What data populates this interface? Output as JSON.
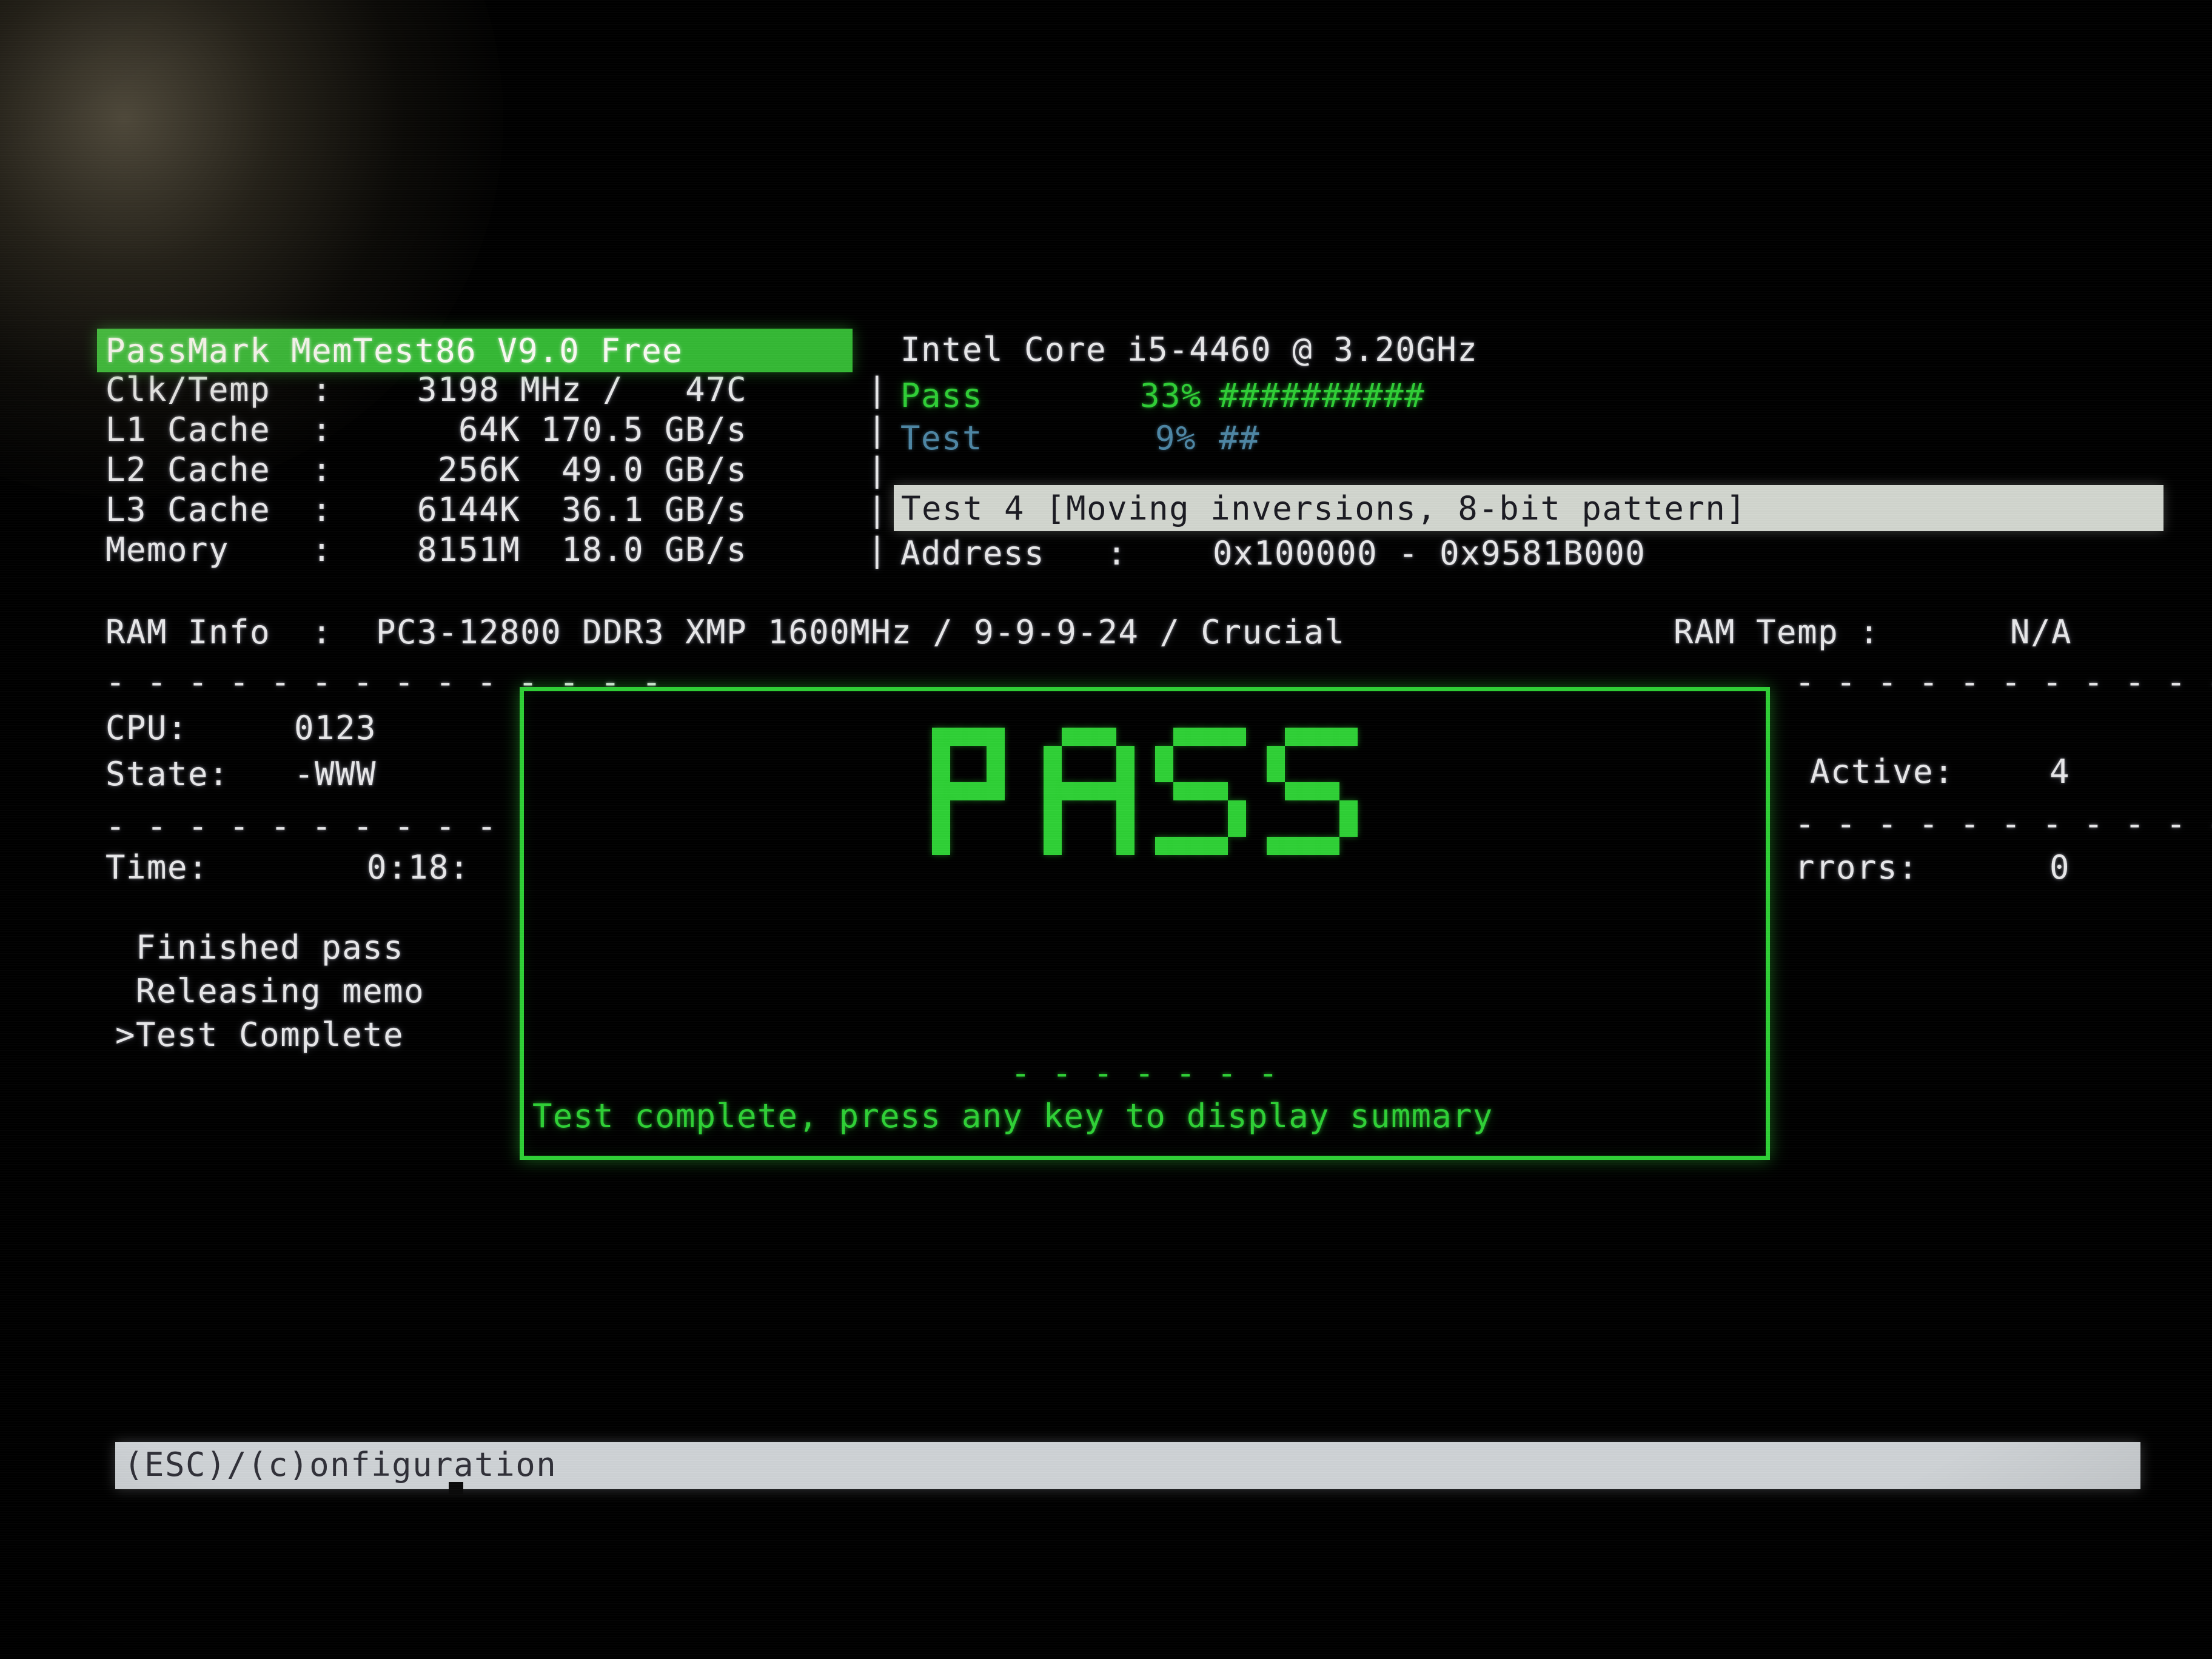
{
  "app": {
    "title": "PassMark MemTest86 V9.0 Free",
    "cpu_model": "Intel Core i5-4460 @ 3.20GHz"
  },
  "system_info": {
    "rows": [
      {
        "label": "Clk/Temp  :",
        "value": "  3198 MHz /   47C"
      },
      {
        "label": "L1 Cache  :",
        "value": "    64K 170.5 GB/s"
      },
      {
        "label": "L2 Cache  :",
        "value": "   256K  49.0 GB/s"
      },
      {
        "label": "L3 Cache  :",
        "value": "  6144K  36.1 GB/s"
      },
      {
        "label": "Memory    :",
        "value": "  8151M  18.0 GB/s"
      }
    ],
    "ram_info_label": "RAM Info  :",
    "ram_info_value": "PC3-12800 DDR3 XMP 1600MHz / 9-9-9-24 / Crucial",
    "ram_temp_label": "RAM Temp :",
    "ram_temp_value": "N/A"
  },
  "progress": {
    "pass_label": "Pass",
    "pass_percent": "33%",
    "pass_bar": "##########",
    "test_label": "Test",
    "test_percent": "9%",
    "test_bar": "##"
  },
  "current_test": {
    "text": "Test 4 [Moving inversions, 8-bit pattern]"
  },
  "address": {
    "label": "Address   :",
    "value": "0x100000 - 0x9581B000"
  },
  "cpu_panel": {
    "separator_top": "- - - - - - - - - - - - - -",
    "cpu_label": "CPU:",
    "cpu_value": "0123",
    "state_label": "State:",
    "state_value": "-WWW",
    "separator_bottom": "- - - - - - - - - - - - - -",
    "time_label": "Time:",
    "time_value": "0:18:"
  },
  "log": {
    "lines": [
      " Finished pass",
      " Releasing memo",
      ">Test Complete"
    ]
  },
  "right_panel": {
    "separator_top": "- - - - - - - - - - - - -",
    "active_label": "Active:",
    "active_value": "4",
    "separator_bottom": "- - - - - - - - - - - - -",
    "errors_label": "rrors:",
    "errors_value": "0"
  },
  "pass_dialog": {
    "headline": "PASS",
    "separator": "- - - - - - -",
    "message": "Test complete, press any key to display summary"
  },
  "status_bar": {
    "text": "(ESC)/(c)onfiguration"
  },
  "colors": {
    "accent_green": "#2fd136",
    "title_bg_green": "#35b935",
    "highlight_bg": "#d2d6cf",
    "status_bg": "#cfd3d6",
    "text_white": "#e8e8ea",
    "text_dim_cyan": "#4e86a4",
    "background": "#000000"
  }
}
